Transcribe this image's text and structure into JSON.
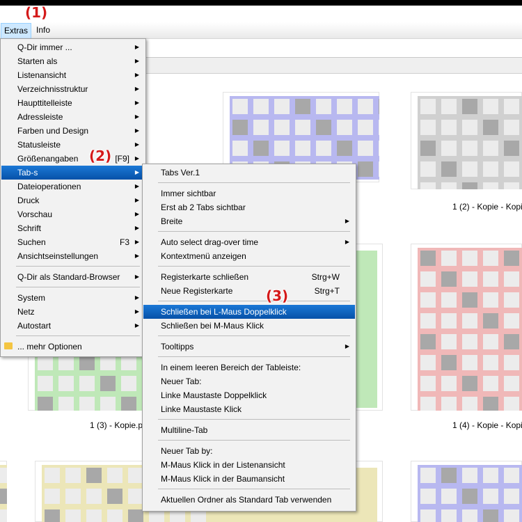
{
  "callouts": {
    "c1": "(1)",
    "c2": "(2)",
    "c3": "(3)"
  },
  "menubar": {
    "extras": "Extras",
    "info": "Info"
  },
  "extras_menu": [
    {
      "label": "Q-Dir immer ...",
      "arrow": true
    },
    {
      "label": "Starten als",
      "arrow": true
    },
    {
      "label": "Listenansicht",
      "arrow": true
    },
    {
      "label": "Verzeichnisstruktur",
      "arrow": true
    },
    {
      "label": "Haupttitelleiste",
      "arrow": true
    },
    {
      "label": "Adressleiste",
      "arrow": true
    },
    {
      "label": "Farben und Design",
      "arrow": true
    },
    {
      "label": "Statusleiste",
      "arrow": true
    },
    {
      "label": "Größenangaben",
      "shortcut": "[F9]",
      "arrow": true
    },
    {
      "label": "Tab-s",
      "arrow": true,
      "highlight": true
    },
    {
      "label": "Dateioperationen",
      "arrow": true
    },
    {
      "label": "Druck",
      "arrow": true
    },
    {
      "label": "Vorschau",
      "arrow": true
    },
    {
      "label": "Schrift",
      "arrow": true
    },
    {
      "label": "Suchen",
      "shortcut": "F3",
      "arrow": true
    },
    {
      "label": "Ansichtseinstellungen",
      "arrow": true
    },
    {
      "label": "Q-Dir als Standard-Browser",
      "arrow": true
    },
    {
      "label": "System",
      "arrow": true
    },
    {
      "label": "Netz",
      "arrow": true
    },
    {
      "label": "Autostart",
      "arrow": true
    },
    {
      "label": "... mehr Optionen",
      "arrow": false
    }
  ],
  "tabs_menu": [
    {
      "label": "Tabs Ver.1"
    },
    {
      "label": "Immer sichtbar"
    },
    {
      "label": "Erst ab 2 Tabs sichtbar"
    },
    {
      "label": "Breite",
      "arrow": true
    },
    {
      "label": "Auto select drag-over time",
      "arrow": true
    },
    {
      "label": "Kontextmenü anzeigen"
    },
    {
      "label": "Registerkarte schließen",
      "shortcut": "Strg+W"
    },
    {
      "label": "Neue Registerkarte",
      "shortcut": "Strg+T"
    },
    {
      "label": "Schließen bei L-Maus Doppelklick",
      "highlight": true
    },
    {
      "label": "Schließen bei M-Maus Klick"
    },
    {
      "label": "Tooltipps",
      "arrow": true
    },
    {
      "label": "In einem leeren Bereich der Tableiste:"
    },
    {
      "label": "Neuer Tab:"
    },
    {
      "label": "Linke Maustaste Doppelklick"
    },
    {
      "label": "Linke Maustaste Klick"
    },
    {
      "label": "Multiline-Tab"
    },
    {
      "label": "Neuer Tab by:"
    },
    {
      "label": "M-Maus Klick in der Listenansicht"
    },
    {
      "label": "M-Maus Klick in der Baumansicht"
    },
    {
      "label": "Aktuellen Ordner als Standard Tab verwenden"
    }
  ],
  "captions": {
    "c1": "1 (2) - Kopie - Kopi",
    "c2": "1 (3) - Kopie.p",
    "c3": "1 (4) - Kopie - Kopi"
  },
  "colors": {
    "blue": "#b8b8f0",
    "gray": "#d0d0d0",
    "green": "#bfe8b8",
    "red": "#f0b8b8",
    "yellow": "#ece6b8",
    "accent": "#0a63c4",
    "callout": "#d41a1a"
  }
}
